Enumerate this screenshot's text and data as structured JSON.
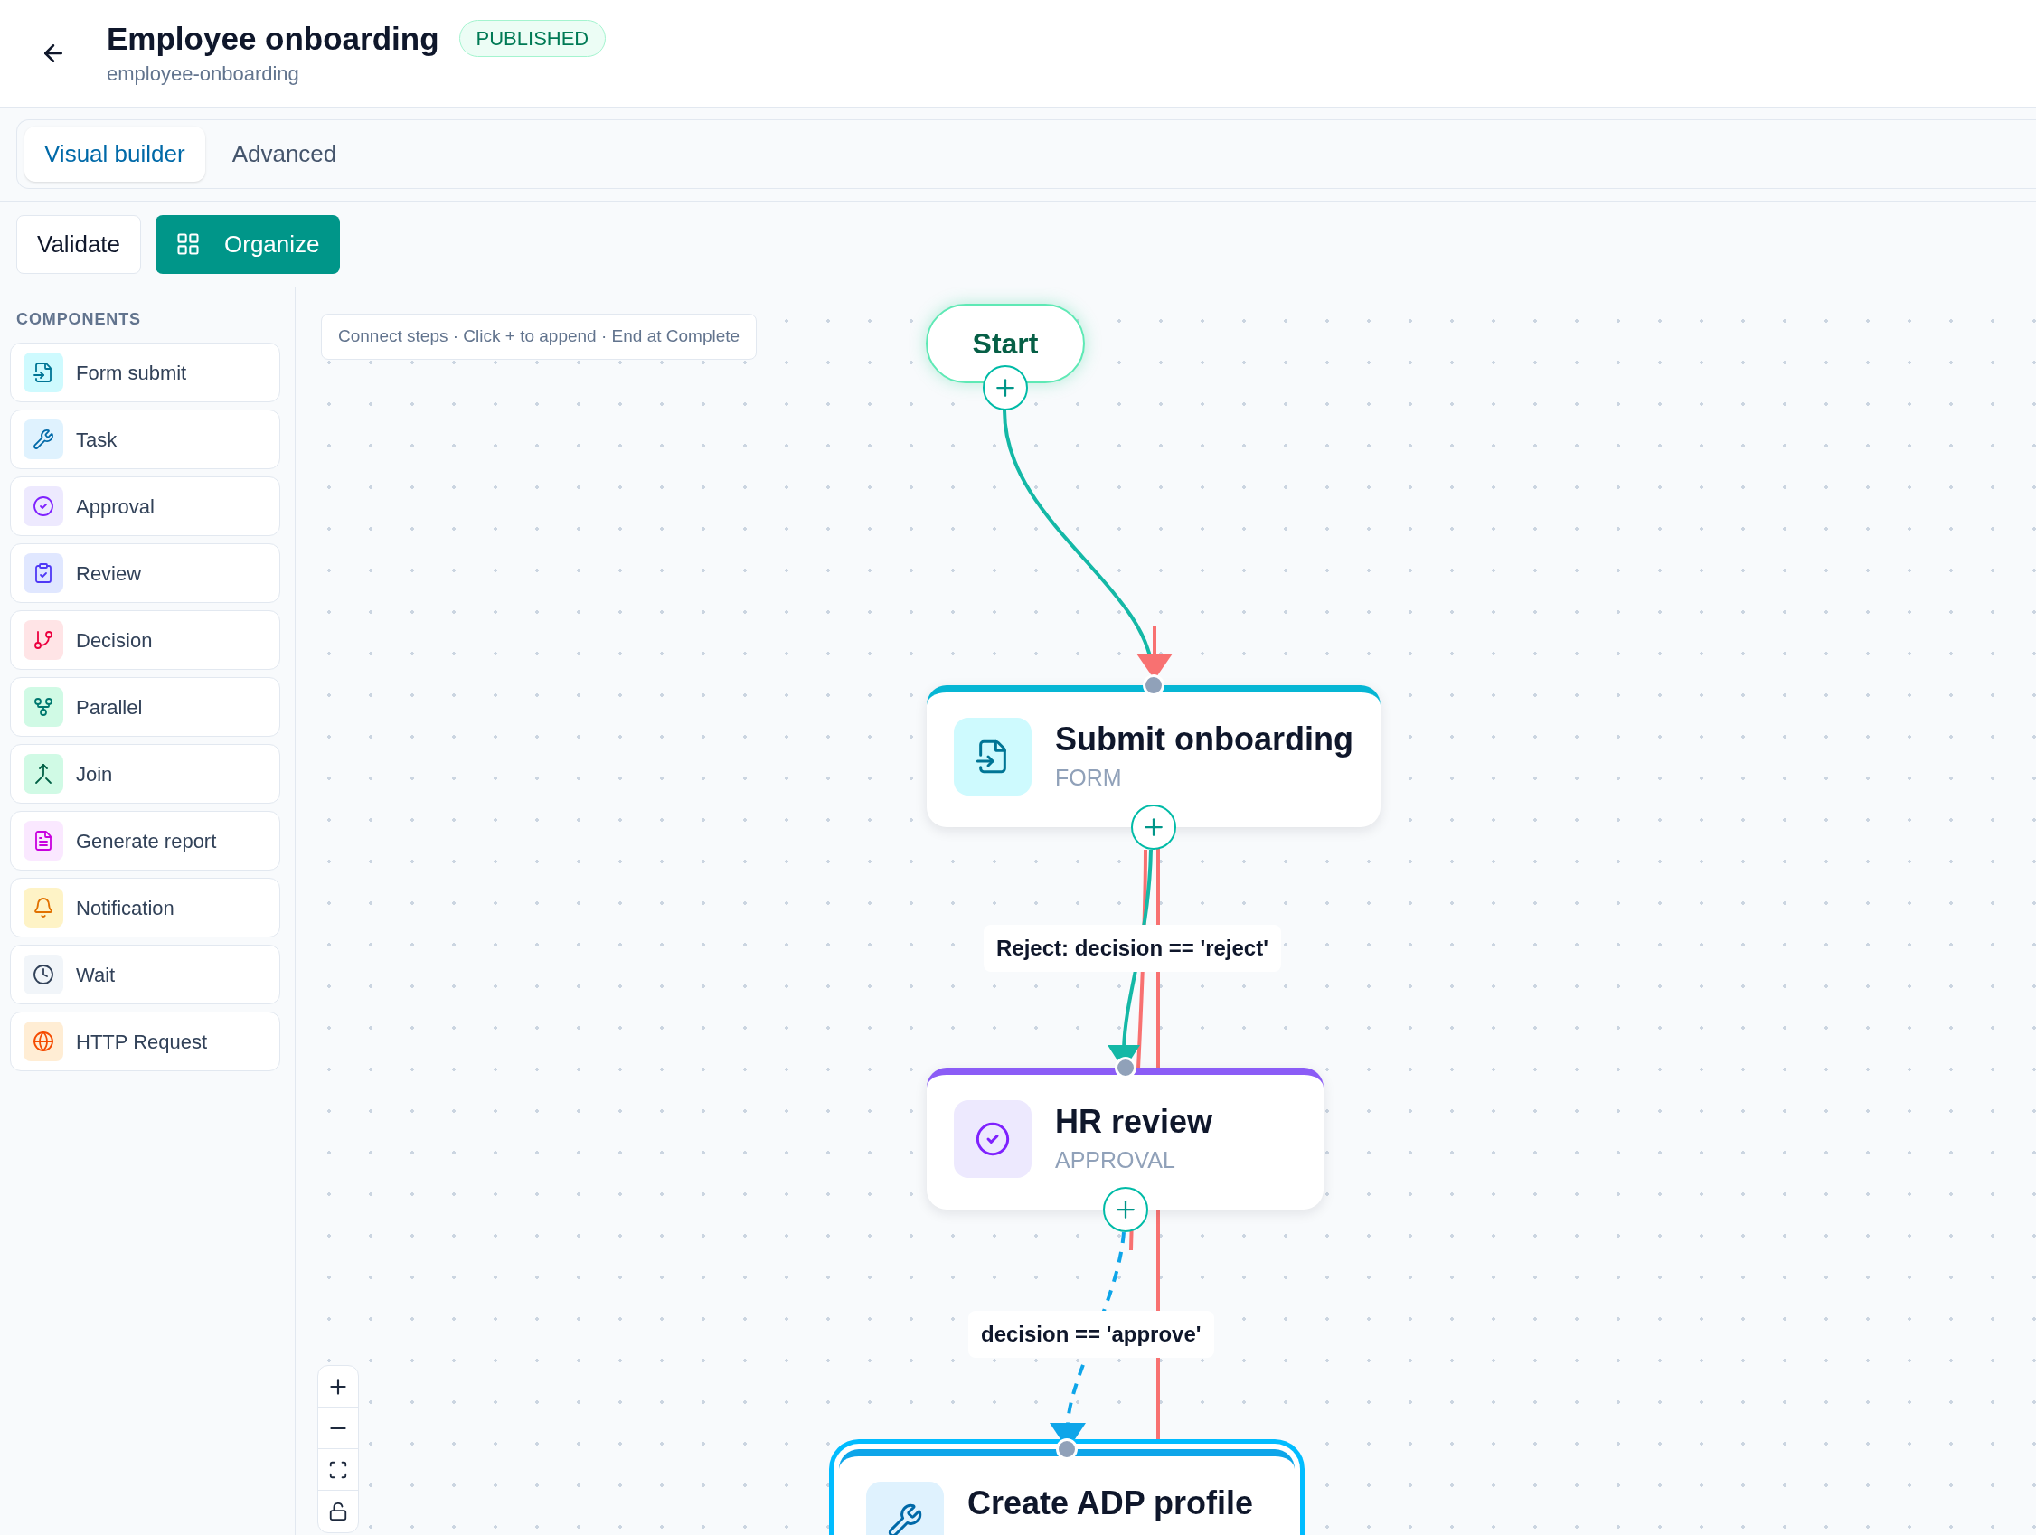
{
  "header": {
    "title": "Employee onboarding",
    "slug": "employee-onboarding",
    "status": "PUBLISHED"
  },
  "tabs": [
    {
      "label": "Visual builder",
      "selected": true
    },
    {
      "label": "Advanced",
      "selected": false
    }
  ],
  "toolbar": [
    {
      "label": "Validate",
      "kind": "secondary"
    },
    {
      "label": "Organize",
      "kind": "primary"
    }
  ],
  "sidebar": {
    "heading": "COMPONENTS",
    "items": [
      {
        "label": "Form submit",
        "kind": "form"
      },
      {
        "label": "Task",
        "kind": "task"
      },
      {
        "label": "Approval",
        "kind": "approval"
      },
      {
        "label": "Review",
        "kind": "review"
      },
      {
        "label": "Decision",
        "kind": "decision"
      },
      {
        "label": "Parallel",
        "kind": "parallel"
      },
      {
        "label": "Join",
        "kind": "join"
      },
      {
        "label": "Generate report",
        "kind": "report"
      },
      {
        "label": "Notification",
        "kind": "notification"
      },
      {
        "label": "Wait",
        "kind": "wait"
      },
      {
        "label": "HTTP Request",
        "kind": "http"
      }
    ]
  },
  "canvas": {
    "hint": "Connect steps · Click + to append · End at Complete",
    "nodes": [
      {
        "kind": "start",
        "title": "Start"
      },
      {
        "kind": "form",
        "title": "Submit onboarding",
        "type": "FORM",
        "color": "#06b6d4",
        "selected": false
      },
      {
        "kind": "approval",
        "title": "HR review",
        "type": "APPROVAL",
        "color": "#8b5cf6",
        "selected": false
      },
      {
        "kind": "task",
        "title": "Create ADP profile",
        "color": "#0ea5e9",
        "selected": true
      }
    ],
    "edge_labels": [
      "Reject: decision == 'reject'",
      "decision == 'approve'"
    ]
  }
}
